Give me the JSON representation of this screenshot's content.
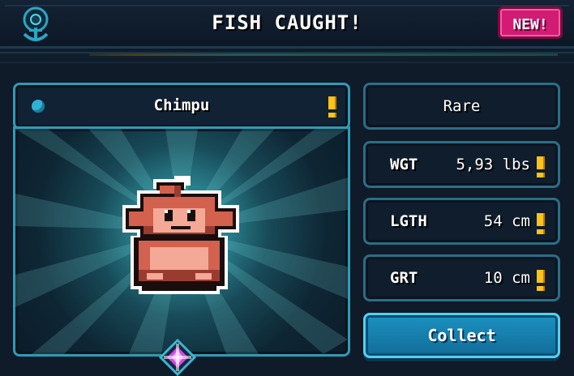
{
  "header": {
    "title": "FISH CAUGHT!",
    "new_badge": "NEW!"
  },
  "fish": {
    "name": "Chimpu"
  },
  "stats": {
    "rarity": "Rare",
    "weight_label": "WGT",
    "weight_value": "5,93 lbs",
    "length_label": "LGTH",
    "length_value": "54 cm",
    "girth_label": "GRT",
    "girth_value": "10 cm"
  },
  "actions": {
    "collect_label": "Collect"
  },
  "colors": {
    "accent_cyan": "#2f9bb4",
    "new_badge": "#d21b72",
    "alert_yellow": "#ffc21a",
    "collect_button": "#1c91c0"
  },
  "icons": {
    "emblem": "anchor-emblem-icon",
    "fish_type": "fish-type-icon",
    "alert": "exclamation-icon",
    "gem": "gem-icon"
  }
}
